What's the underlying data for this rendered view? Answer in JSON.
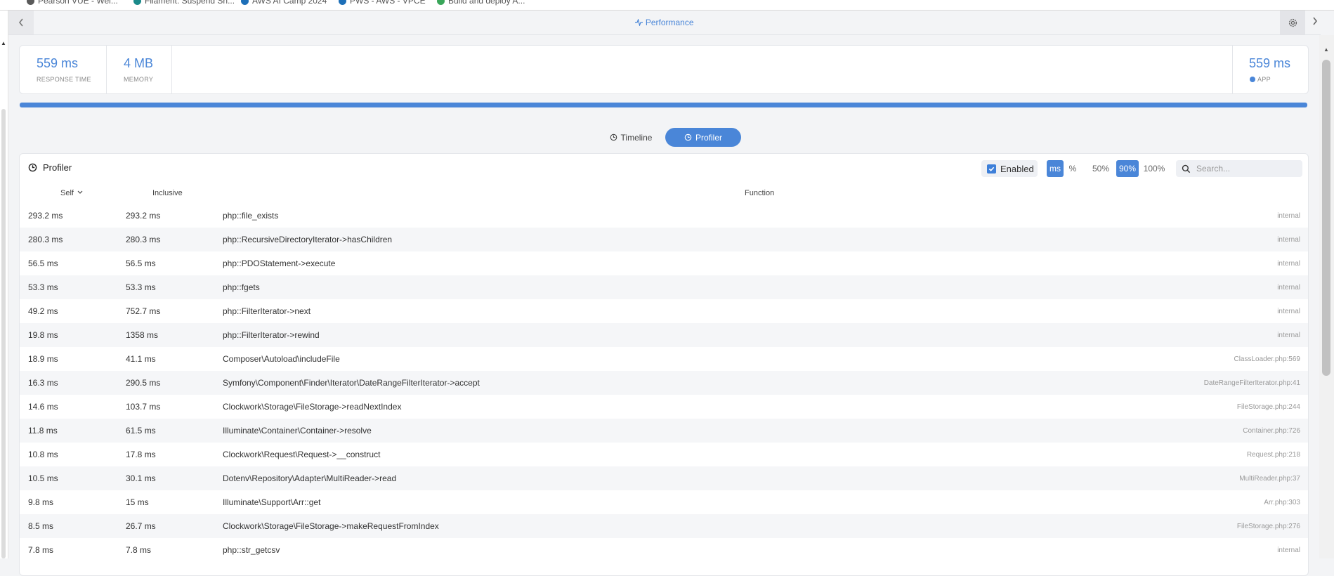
{
  "browser": {
    "bookmarks": [
      {
        "label": "Pearson VUE - Wel...",
        "color": "#5a5a5a"
      },
      {
        "label": "Filament: Suspend Sh...",
        "color": "#1b8a8a"
      },
      {
        "label": "AWS AI Camp 2024",
        "color": "#1d6fb8"
      },
      {
        "label": "PWS - AWS - VPCE",
        "color": "#1d6fb8"
      },
      {
        "label": "Build and deploy A...",
        "color": "#3aa65a"
      }
    ]
  },
  "topbar": {
    "title": "Performance",
    "back_icon": "chevron-left-icon",
    "settings_icon": "gear-icon",
    "forward_icon": "chevron-right-icon"
  },
  "summary": {
    "response_time": {
      "value": "559 ms",
      "label": "RESPONSE TIME"
    },
    "memory": {
      "value": "4 MB",
      "label": "MEMORY"
    },
    "app": {
      "value": "559 ms",
      "label": "APP",
      "color": "#4a86d8"
    },
    "progress": 1.0
  },
  "tabs": [
    {
      "label": "Timeline",
      "active": false
    },
    {
      "label": "Profiler",
      "active": true
    }
  ],
  "profiler": {
    "title": "Profiler",
    "enabled_label": "Enabled",
    "enabled": true,
    "units": [
      "ms",
      "%"
    ],
    "active_unit": "ms",
    "thresholds": [
      "50%",
      "90%",
      "100%"
    ],
    "active_threshold": "90%",
    "search_placeholder": "Search...",
    "columns": {
      "self": "Self",
      "inclusive": "Inclusive",
      "function": "Function"
    },
    "rows": [
      {
        "self": "293.2 ms",
        "inclusive": "293.2 ms",
        "function": "php::file_exists",
        "source": "internal"
      },
      {
        "self": "280.3 ms",
        "inclusive": "280.3 ms",
        "function": "php::RecursiveDirectoryIterator->hasChildren",
        "source": "internal"
      },
      {
        "self": "56.5 ms",
        "inclusive": "56.5 ms",
        "function": "php::PDOStatement->execute",
        "source": "internal"
      },
      {
        "self": "53.3 ms",
        "inclusive": "53.3 ms",
        "function": "php::fgets",
        "source": "internal"
      },
      {
        "self": "49.2 ms",
        "inclusive": "752.7 ms",
        "function": "php::FilterIterator->next",
        "source": "internal"
      },
      {
        "self": "19.8 ms",
        "inclusive": "1358 ms",
        "function": "php::FilterIterator->rewind",
        "source": "internal"
      },
      {
        "self": "18.9 ms",
        "inclusive": "41.1 ms",
        "function": "Composer\\Autoload\\includeFile",
        "source": "ClassLoader.php:569"
      },
      {
        "self": "16.3 ms",
        "inclusive": "290.5 ms",
        "function": "Symfony\\Component\\Finder\\Iterator\\DateRangeFilterIterator->accept",
        "source": "DateRangeFilterIterator.php:41"
      },
      {
        "self": "14.6 ms",
        "inclusive": "103.7 ms",
        "function": "Clockwork\\Storage\\FileStorage->readNextIndex",
        "source": "FileStorage.php:244"
      },
      {
        "self": "11.8 ms",
        "inclusive": "61.5 ms",
        "function": "Illuminate\\Container\\Container->resolve",
        "source": "Container.php:726"
      },
      {
        "self": "10.8 ms",
        "inclusive": "17.8 ms",
        "function": "Clockwork\\Request\\Request->__construct",
        "source": "Request.php:218"
      },
      {
        "self": "10.5 ms",
        "inclusive": "30.1 ms",
        "function": "Dotenv\\Repository\\Adapter\\MultiReader->read",
        "source": "MultiReader.php:37"
      },
      {
        "self": "9.8 ms",
        "inclusive": "15 ms",
        "function": "Illuminate\\Support\\Arr::get",
        "source": "Arr.php:303"
      },
      {
        "self": "8.5 ms",
        "inclusive": "26.7 ms",
        "function": "Clockwork\\Storage\\FileStorage->makeRequestFromIndex",
        "source": "FileStorage.php:276"
      },
      {
        "self": "7.8 ms",
        "inclusive": "7.8 ms",
        "function": "php::str_getcsv",
        "source": "internal"
      }
    ]
  }
}
